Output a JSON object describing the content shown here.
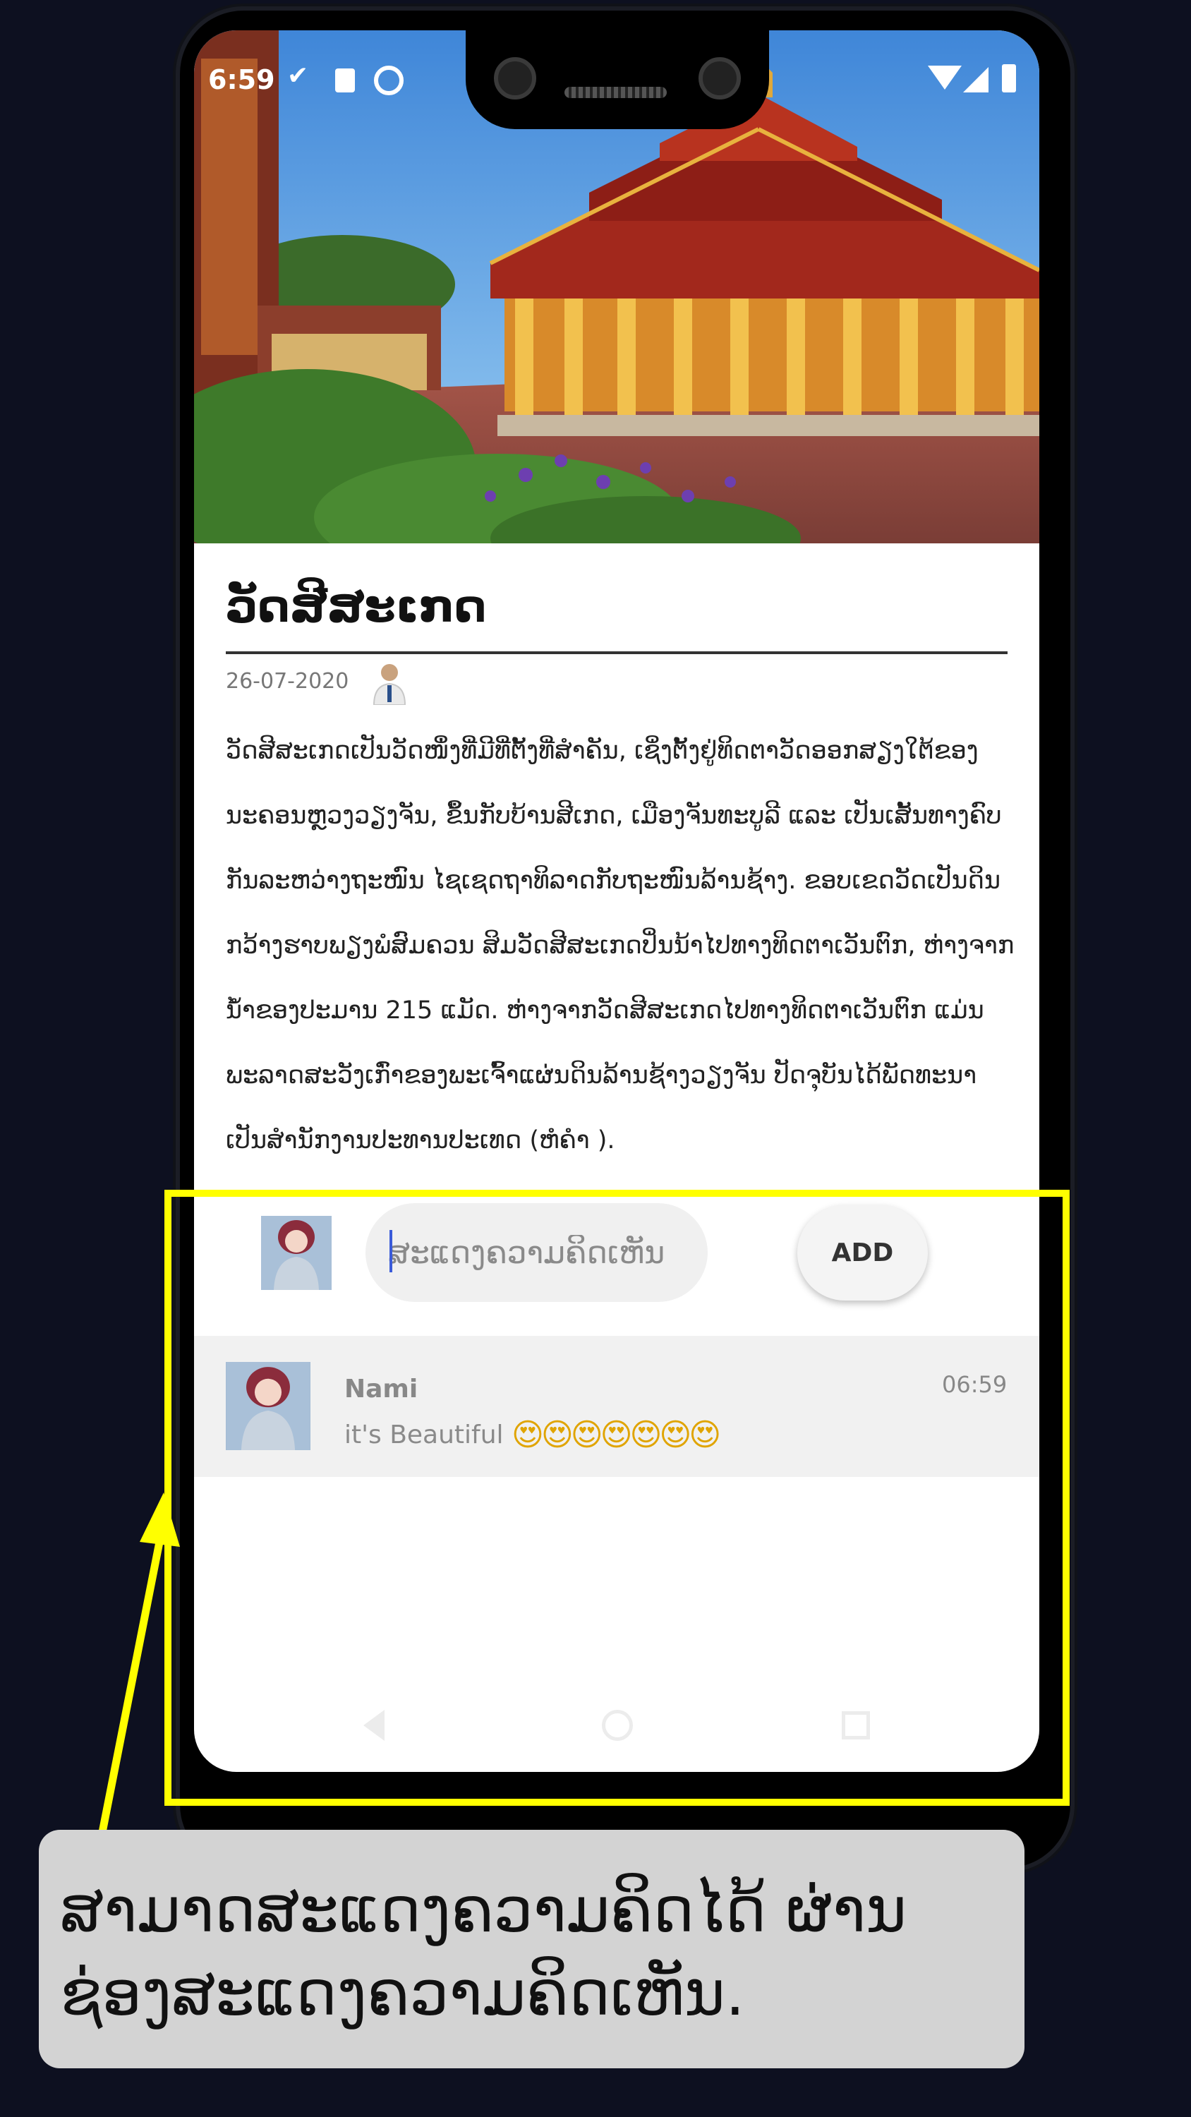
{
  "status_bar": {
    "time": "6:59",
    "left_icons": [
      "check-download-icon",
      "sd-card-icon",
      "sync-icon"
    ],
    "right_icons": [
      "wifi-icon",
      "signal-icon",
      "battery-icon"
    ]
  },
  "article": {
    "title": "ວັດສີສະເກດ",
    "date": "26-07-2020",
    "body": "ວັດສີສະເກດເປັນວັດໜຶ່ງທີ່ມີທີ່ຕັ້ງທີ່ສຳຄັນ, ເຊິ່ງຕັ້ງຢູ່ທິດຕາວັດອອກສຽງໃຕ້ຂອງນະຄອນຫຼວງວຽງຈັນ, ຂຶ້ນກັບບ້ານສີເກດ, ເມືອງຈັນທະບູລີ ແລະ ເປັນເສັ້ນທາງຄົບກັນລະຫວ່າງຖະໜົນ ໄຊເຊດຖາທິລາດກັບຖະໜົນລ້ານຊ້າງ. ຂອບເຂດວັດເປັນດິນກວ້າງຮາບພຽງພໍສົມຄວນ ສິມວັດສີສະເກດປິ່ນນ້າໄປທາງທິດຕາເວັນຕົກ, ຫ່າງຈາກນ້ຳຂອງປະມານ 215 ແມັດ. ຫ່າງຈາກວັດສີສະເກດໄປທາງທິດຕາເວັນຕົກ ແມ່ນພະລາດສະວັງເກົ່າຂອງພະເຈົ້າແຜ່ນດິນລ້ານຊ້າງວຽງຈັນ ປັດຈຸບັນໄດ້ພັດທະນາເປັນສຳນັກງານປະທານປະເທດ (ຫໍຄຳ )."
  },
  "comment_form": {
    "placeholder": "ສະແດງຄວາມຄິດເຫັນ",
    "add_label": "ADD"
  },
  "comments": [
    {
      "name": "Nami",
      "time": "06:59",
      "text": "it's Beautiful",
      "emojis": "😍😍😍😍😍😍😍"
    }
  ],
  "callout": {
    "text": "ສາມາດສະແດງຄວາມຄິດໄດ້ ຜ່ານຊ່ອງສະແດງຄວາມຄິດເຫັນ."
  },
  "colors": {
    "background": "#0d1020",
    "highlight": "#ffff00",
    "callout_bg": "#d3d3d3"
  }
}
